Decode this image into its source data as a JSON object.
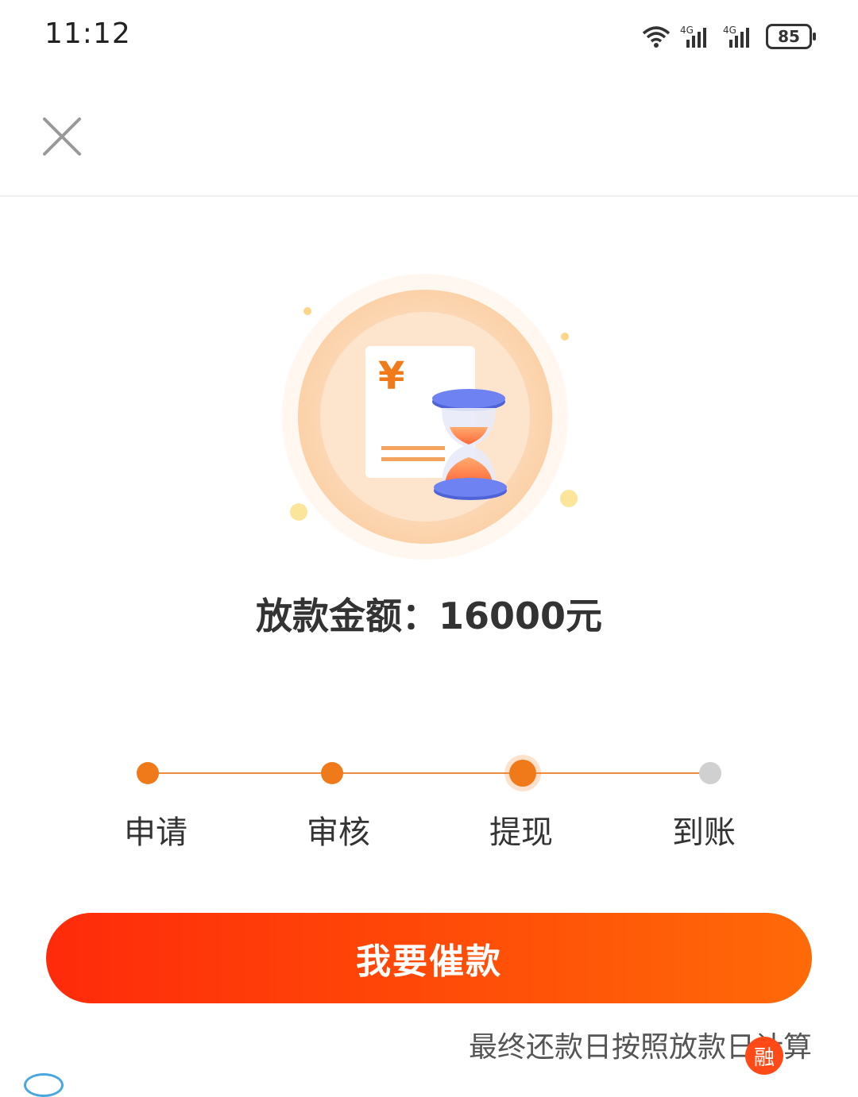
{
  "status_bar": {
    "time": "11:12",
    "battery": "85",
    "network": [
      "4G",
      "4G"
    ]
  },
  "nav": {
    "close_icon": "close-icon"
  },
  "illustration": {
    "currency_symbol": "¥",
    "icon": "hourglass-icon"
  },
  "amount": {
    "text": "放款金额：16000元"
  },
  "steps": [
    {
      "label": "申请",
      "state": "done"
    },
    {
      "label": "审核",
      "state": "done"
    },
    {
      "label": "提现",
      "state": "current"
    },
    {
      "label": "到账",
      "state": "pending"
    }
  ],
  "button": {
    "label": "我要催款"
  },
  "note": {
    "text": "最终还款日按照放款日计算"
  },
  "watermark": {
    "text": "融"
  },
  "colors": {
    "accent": "#f07a1a",
    "button_start": "#ff2a0a",
    "button_end": "#ff6a08",
    "pending": "#d0d0d0"
  }
}
